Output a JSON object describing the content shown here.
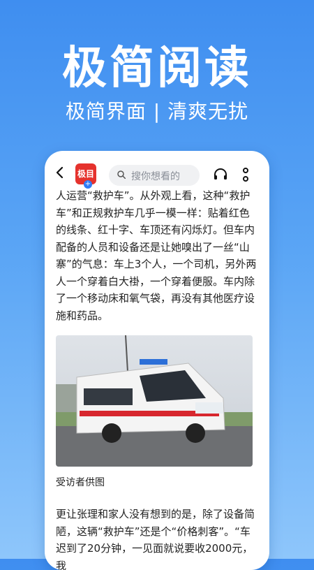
{
  "promo": {
    "headline": "极简阅读",
    "subline": "极简界面 | 清爽无扰"
  },
  "toolbar": {
    "logo_text": "极目",
    "search_placeholder": "搜你想看的"
  },
  "article": {
    "paragraph1": "人运营“救护车”。从外观上看，这种“救护车”和正规救护车几乎一模一样：贴着红色的线条、红十字、车顶还有闪烁灯。但车内配备的人员和设备还是让她嗅出了一丝“山寨”的气息：车上3个人，一个司机，另外两人一个穿着白大褂，一个穿着便服。车内除了一个移动床和氧气袋，再没有其他医疗设施和药品。",
    "image_caption": "受访者供图",
    "paragraph2": "更让张理和家人没有想到的是，除了设备简陋，这辆“救护车”还是个“价格刺客”。“车迟到了20分钟，一见面就说要收2000元，我"
  },
  "colors": {
    "background_top": "#3f8ef0",
    "logo_red": "#e5322d"
  }
}
